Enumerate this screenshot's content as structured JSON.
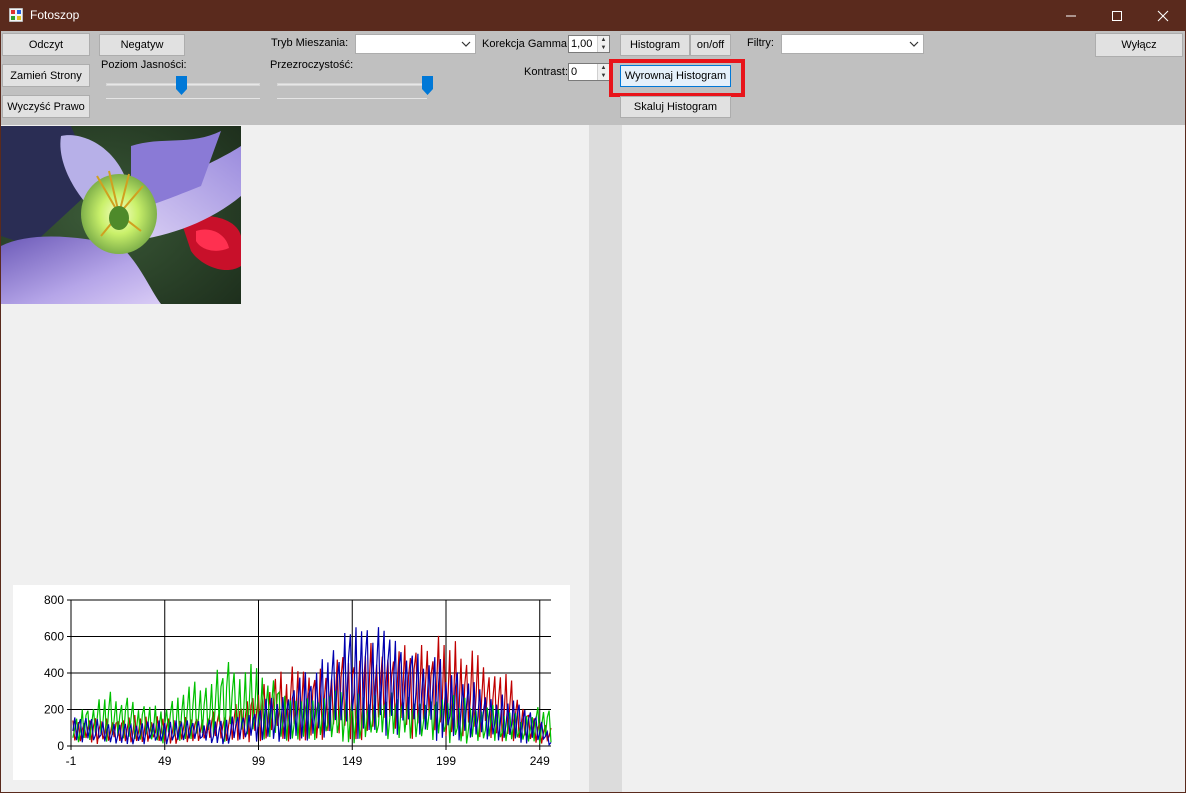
{
  "window": {
    "title": "Fotoszop",
    "app_icon": "app-icon"
  },
  "toolbar": {
    "odczyt": "Odczyt",
    "zamien_strony": "Zamień Strony",
    "wyczysc_prawo": "Wyczyść Prawo",
    "negatyw": "Negatyw",
    "poziom_jasnosci_label": "Poziom Jasności:",
    "poziom_jasnosci_value": 0.5,
    "tryb_mieszania_label": "Tryb Mieszania:",
    "tryb_mieszania_value": "",
    "przezroczystosc_label": "Przezroczystość:",
    "przezroczystosc_value": 1.0,
    "korekcja_gamma_label": "Korekcja Gamma:",
    "korekcja_gamma_value": "1,00",
    "kontrast_label": "Kontrast:",
    "kontrast_value": "0",
    "histogram": "Histogram",
    "on_off": "on/off",
    "wyrownaj_histogram": "Wyrownaj Histogram",
    "skaluj_histogram": "Skaluj Histogram",
    "filtry_label": "Filtry:",
    "filtry_value": "",
    "wylacz": "Wyłącz"
  },
  "chart_data": {
    "type": "line",
    "title": "",
    "xlabel": "",
    "ylabel": "",
    "xlim": [
      -1,
      255
    ],
    "ylim": [
      0,
      800
    ],
    "x_ticks": [
      "-1",
      "49",
      "99",
      "149",
      "199",
      "249"
    ],
    "y_ticks": [
      "0",
      "200",
      "400",
      "600",
      "800"
    ],
    "grid": true,
    "series": [
      {
        "color": "#c00000",
        "envelope": [
          [
            0,
            160
          ],
          [
            20,
            170
          ],
          [
            40,
            170
          ],
          [
            60,
            160
          ],
          [
            80,
            200
          ],
          [
            100,
            330
          ],
          [
            110,
            420
          ],
          [
            120,
            470
          ],
          [
            130,
            460
          ],
          [
            140,
            500
          ],
          [
            150,
            560
          ],
          [
            160,
            580
          ],
          [
            170,
            540
          ],
          [
            180,
            560
          ],
          [
            190,
            610
          ],
          [
            200,
            600
          ],
          [
            210,
            550
          ],
          [
            220,
            500
          ],
          [
            230,
            440
          ],
          [
            240,
            260
          ],
          [
            250,
            130
          ],
          [
            255,
            100
          ]
        ]
      },
      {
        "color": "#00c000",
        "envelope": [
          [
            0,
            180
          ],
          [
            10,
            250
          ],
          [
            20,
            300
          ],
          [
            30,
            280
          ],
          [
            40,
            220
          ],
          [
            50,
            240
          ],
          [
            60,
            350
          ],
          [
            70,
            420
          ],
          [
            80,
            470
          ],
          [
            90,
            440
          ],
          [
            100,
            470
          ],
          [
            110,
            380
          ],
          [
            120,
            280
          ],
          [
            130,
            290
          ],
          [
            140,
            320
          ],
          [
            150,
            310
          ],
          [
            160,
            300
          ],
          [
            170,
            300
          ],
          [
            180,
            300
          ],
          [
            190,
            300
          ],
          [
            200,
            300
          ],
          [
            210,
            260
          ],
          [
            220,
            240
          ],
          [
            230,
            210
          ],
          [
            240,
            160
          ],
          [
            250,
            230
          ],
          [
            255,
            200
          ]
        ]
      },
      {
        "color": "#0000b0",
        "envelope": [
          [
            0,
            170
          ],
          [
            20,
            150
          ],
          [
            40,
            140
          ],
          [
            60,
            150
          ],
          [
            80,
            140
          ],
          [
            100,
            250
          ],
          [
            110,
            300
          ],
          [
            120,
            380
          ],
          [
            130,
            450
          ],
          [
            140,
            570
          ],
          [
            150,
            690
          ],
          [
            160,
            720
          ],
          [
            170,
            660
          ],
          [
            180,
            590
          ],
          [
            190,
            510
          ],
          [
            200,
            460
          ],
          [
            210,
            400
          ],
          [
            220,
            330
          ],
          [
            230,
            280
          ],
          [
            240,
            220
          ],
          [
            250,
            170
          ],
          [
            255,
            40
          ]
        ]
      }
    ]
  }
}
